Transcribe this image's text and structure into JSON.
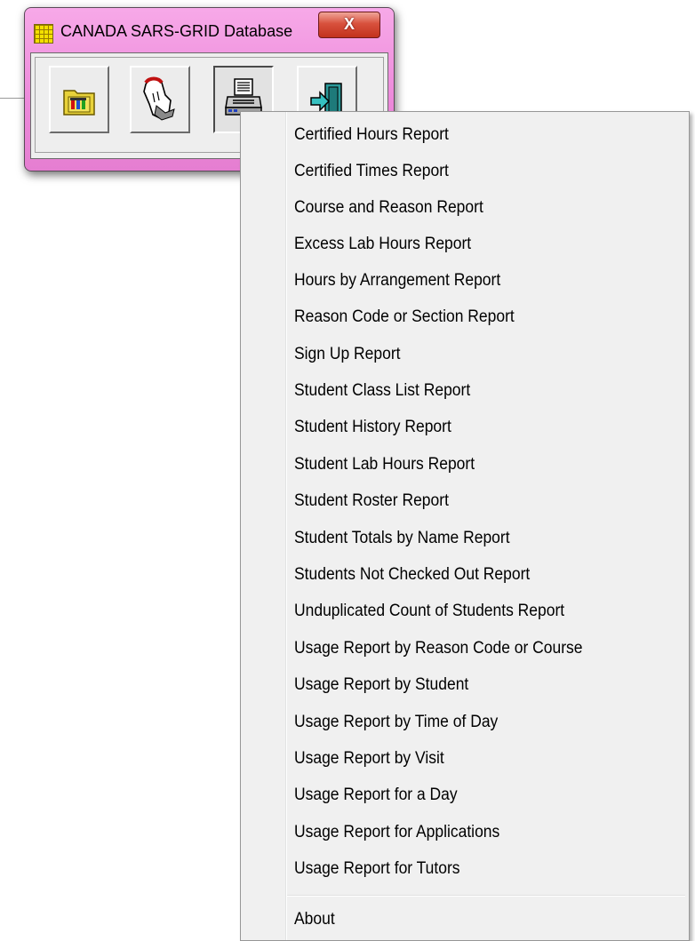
{
  "window": {
    "title": "CANADA SARS-GRID Database",
    "close_label": "X"
  },
  "toolbar": {
    "buttons": [
      {
        "name": "setup-tools-folder-icon"
      },
      {
        "name": "sign-in-hand-icon"
      },
      {
        "name": "printer-reports-icon"
      },
      {
        "name": "exit-door-icon"
      }
    ]
  },
  "menu": {
    "items": [
      "Certified Hours Report",
      "Certified Times Report",
      "Course and Reason Report",
      "Excess Lab Hours Report",
      "Hours by Arrangement Report",
      "Reason Code or Section  Report",
      "Sign Up Report",
      "Student Class List Report",
      "Student History Report",
      "Student Lab Hours Report",
      "Student Roster Report",
      "Student Totals by Name Report",
      "Students Not Checked Out Report",
      "Unduplicated Count of Students Report",
      "Usage Report by Reason Code or Course",
      "Usage Report by Student",
      "Usage Report by Time of Day",
      "Usage Report by Visit",
      "Usage Report for a Day",
      "Usage Report for Applications",
      "Usage Report for Tutors"
    ],
    "about": "About"
  }
}
